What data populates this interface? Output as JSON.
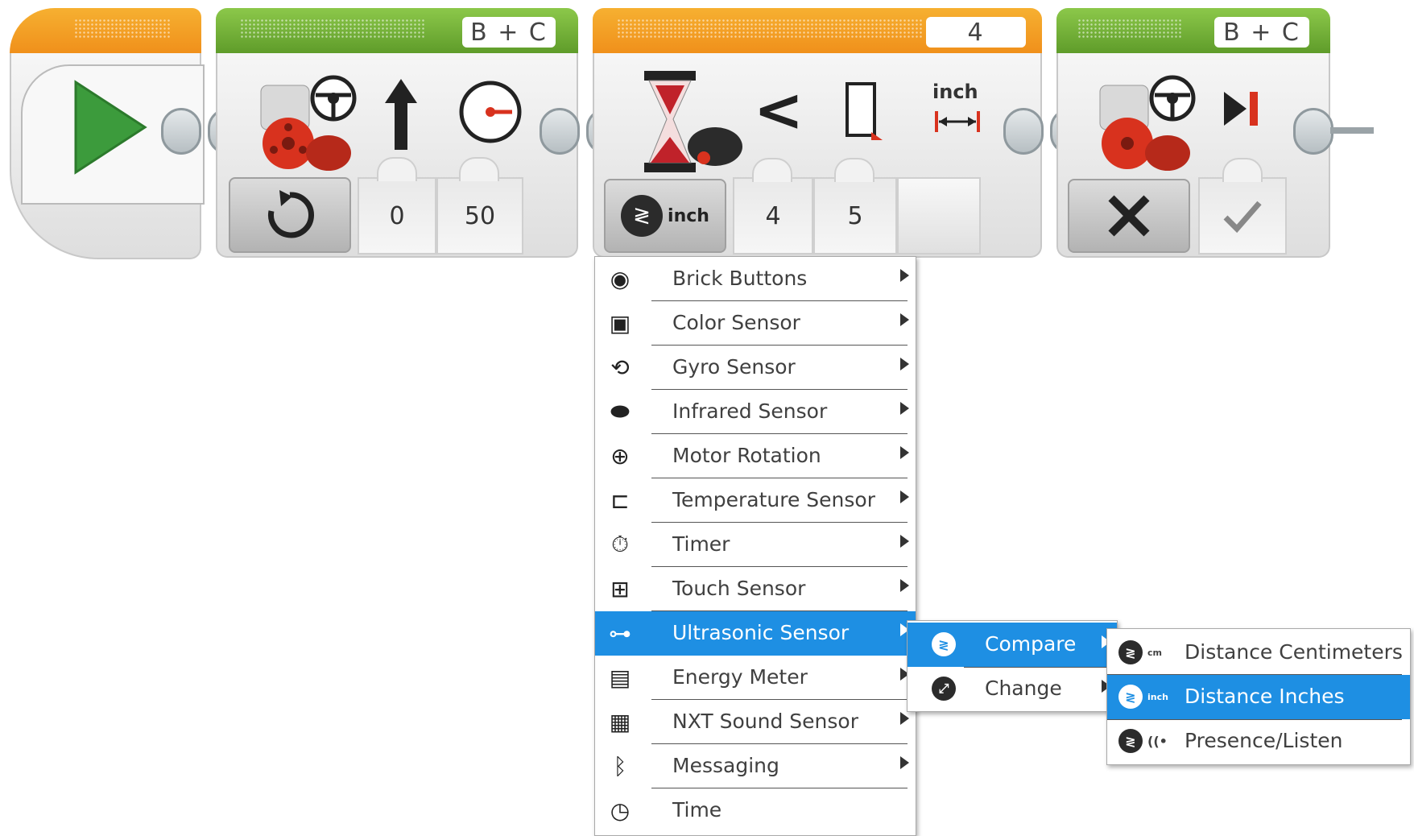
{
  "blocks": {
    "start": {},
    "move_tank_1": {
      "ports": "B + C",
      "power_left": "0",
      "power_right": "50"
    },
    "wait": {
      "port": "4",
      "unit": "inch",
      "mode_unit": "inch",
      "compare_type": "4",
      "threshold": "5"
    },
    "move_tank_2": {
      "ports": "B + C"
    }
  },
  "menu": {
    "items": [
      {
        "label": "Brick Buttons",
        "icon": "brick-buttons-icon",
        "glyph": "◉"
      },
      {
        "label": "Color Sensor",
        "icon": "color-sensor-icon",
        "glyph": "▣"
      },
      {
        "label": "Gyro Sensor",
        "icon": "gyro-sensor-icon",
        "glyph": "⟲"
      },
      {
        "label": "Infrared Sensor",
        "icon": "infrared-sensor-icon",
        "glyph": "⬬"
      },
      {
        "label": "Motor Rotation",
        "icon": "motor-rotation-icon",
        "glyph": "⊕"
      },
      {
        "label": "Temperature Sensor",
        "icon": "temperature-sensor-icon",
        "glyph": "⊏"
      },
      {
        "label": "Timer",
        "icon": "timer-icon",
        "glyph": "⏱"
      },
      {
        "label": "Touch Sensor",
        "icon": "touch-sensor-icon",
        "glyph": "⊞"
      },
      {
        "label": "Ultrasonic Sensor",
        "icon": "ultrasonic-sensor-icon",
        "glyph": "⊶"
      },
      {
        "label": "Energy Meter",
        "icon": "energy-meter-icon",
        "glyph": "▤"
      },
      {
        "label": "NXT Sound Sensor",
        "icon": "nxt-sound-sensor-icon",
        "glyph": "▦"
      },
      {
        "label": "Messaging",
        "icon": "bluetooth-icon",
        "glyph": "ᛒ"
      },
      {
        "label": "Time",
        "icon": "time-icon",
        "glyph": "◷"
      }
    ]
  },
  "submenu": {
    "items": [
      {
        "label": "Compare",
        "icon": "compare-icon"
      },
      {
        "label": "Change",
        "icon": "change-icon"
      }
    ]
  },
  "submenu2": {
    "items": [
      {
        "label": "Distance Centimeters",
        "tag": "cm"
      },
      {
        "label": "Distance Inches",
        "tag": "inch"
      },
      {
        "label": "Presence/Listen",
        "tag": "((•"
      }
    ]
  },
  "colors": {
    "accent": "#1e8fe3",
    "start_header": "#f0901b",
    "action_header": "#5f9c2a"
  }
}
